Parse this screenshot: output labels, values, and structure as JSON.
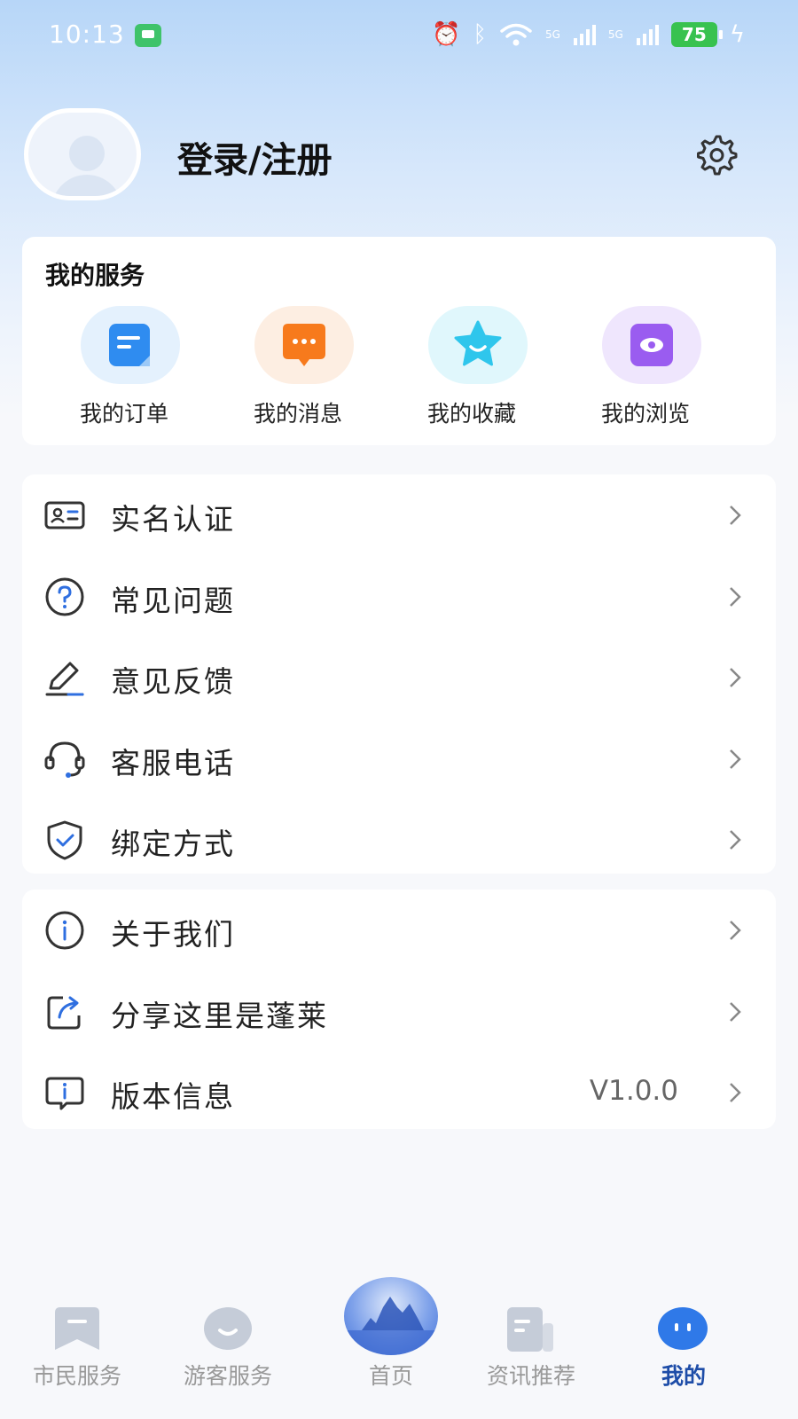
{
  "status_bar": {
    "time": "10:13",
    "battery": "75",
    "network_1": "5G",
    "network_2": "5G"
  },
  "profile": {
    "login_label": "登录/注册"
  },
  "services": {
    "title": "我的服务",
    "items": [
      {
        "label": "我的订单",
        "icon": "order-icon",
        "color": "#2f8cf0"
      },
      {
        "label": "我的消息",
        "icon": "message-icon",
        "color": "#f77a1c"
      },
      {
        "label": "我的收藏",
        "icon": "star-icon",
        "color": "#2fc6ec"
      },
      {
        "label": "我的浏览",
        "icon": "eye-icon",
        "color": "#9a5cf0"
      }
    ]
  },
  "menu_group_1": [
    {
      "label": "实名认证",
      "icon": "id-card-icon"
    },
    {
      "label": "常见问题",
      "icon": "question-icon"
    },
    {
      "label": "意见反馈",
      "icon": "edit-icon"
    },
    {
      "label": "客服电话",
      "icon": "headset-icon"
    },
    {
      "label": "绑定方式",
      "icon": "shield-check-icon"
    }
  ],
  "menu_group_2": [
    {
      "label": "关于我们",
      "icon": "info-icon",
      "value": ""
    },
    {
      "label": "分享这里是蓬莱",
      "icon": "share-icon",
      "value": ""
    },
    {
      "label": "版本信息",
      "icon": "version-info-icon",
      "value": "V1.0.0"
    }
  ],
  "bottom_nav": {
    "items": [
      {
        "label": "市民服务",
        "icon": "citizen-service-icon"
      },
      {
        "label": "游客服务",
        "icon": "tourist-service-icon"
      },
      {
        "label": "首页",
        "icon": "home-icon"
      },
      {
        "label": "资讯推荐",
        "icon": "news-icon"
      },
      {
        "label": "我的",
        "icon": "mine-icon"
      }
    ],
    "active_index": 4,
    "active_color": "#1e4da8",
    "inactive_color": "#999999"
  }
}
